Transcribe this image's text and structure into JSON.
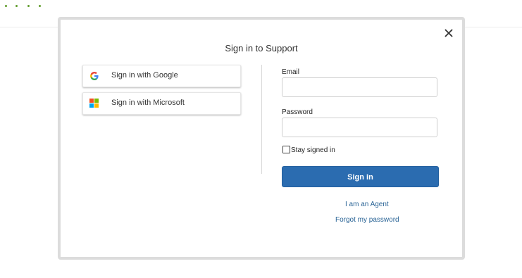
{
  "modal": {
    "title": "Sign in to Support",
    "close_icon": "close-icon"
  },
  "sso": {
    "google_label": "Sign in with Google",
    "google_icon": "google-g-icon",
    "microsoft_label": "Sign in with Microsoft",
    "microsoft_icon": "microsoft-logo-icon"
  },
  "form": {
    "email_label": "Email",
    "email_value": "",
    "password_label": "Password",
    "password_value": "",
    "stay_signed_in_label": "Stay signed in",
    "stay_signed_in_checked": false,
    "submit_label": "Sign in",
    "agent_link": "I am an Agent",
    "forgot_link": "Forgot my password"
  },
  "colors": {
    "primary": "#2b6cb0",
    "link": "#2a6496",
    "loading_dots": "#5f9c2a"
  }
}
